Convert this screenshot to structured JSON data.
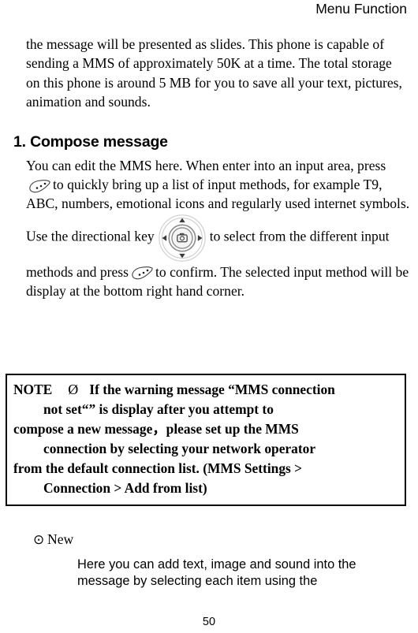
{
  "header": {
    "title": "Menu Function"
  },
  "intro": {
    "text": "the message will be presented as slides. This phone is capable of sending a MMS of approximately 50K at a time. The total storage on this phone is around 5 MB for you to save all your text, pictures, animation and sounds."
  },
  "section": {
    "heading": "1. Compose message",
    "body_1": "You can edit the MMS here. When enter into an input area, press",
    "body_2": "to quickly bring up a list of input methods, for example T9, ABC, numbers, emotional icons and regularly used internet symbols. Use the directional key",
    "body_3": "to select from the different input methods and press",
    "body_4": "to confirm. The selected input method will be display at the bottom right hand corner."
  },
  "note": {
    "label": "NOTE",
    "symbol": "Ø",
    "line_1": "If the warning message “MMS connection",
    "line_2": "not set“” is display after you attempt to",
    "line_3": "compose a new message，please set up the MMS",
    "line_4": "connection by selecting your network operator",
    "line_5": "from the default connection list. (MMS Settings >",
    "line_6": "Connection > Add from list)"
  },
  "bullet": {
    "glyph": "⊙",
    "label": "New",
    "body": "Here you can add text, image and sound into the message by selecting each item using the"
  },
  "footer": {
    "page_number": "50"
  },
  "icons": {
    "softkey": "softkey-icon",
    "navkey": "directional-key-icon"
  },
  "colors": {
    "text": "#000000",
    "background": "#ffffff",
    "note_border": "#000000",
    "icon_stroke": "#4a4a4a"
  }
}
